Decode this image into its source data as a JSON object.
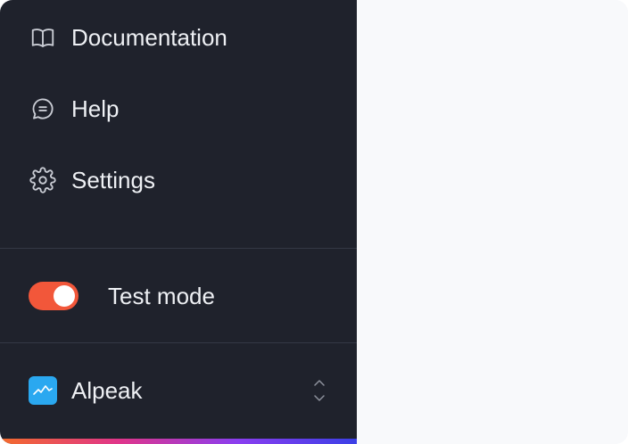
{
  "sidebar": {
    "items": [
      {
        "label": "Documentation",
        "icon": "book-open-icon"
      },
      {
        "label": "Help",
        "icon": "chat-bubble-icon"
      },
      {
        "label": "Settings",
        "icon": "gear-icon"
      }
    ],
    "test_mode": {
      "label": "Test mode",
      "enabled": true
    },
    "workspace": {
      "name": "Alpeak",
      "logo_icon": "mountain-logo-icon",
      "switcher_icon": "chevrons-up-down-icon"
    }
  },
  "colors": {
    "sidebar_bg": "#1f222c",
    "content_bg": "#f8f9fb",
    "text": "#eef0f4",
    "icon": "#c9ccd4",
    "toggle_on": "#f2573a",
    "logo_bg": "#2aa8f0",
    "gradient": [
      "#f36b2c",
      "#e0358a",
      "#8a3ef0",
      "#3b3fe6"
    ]
  }
}
